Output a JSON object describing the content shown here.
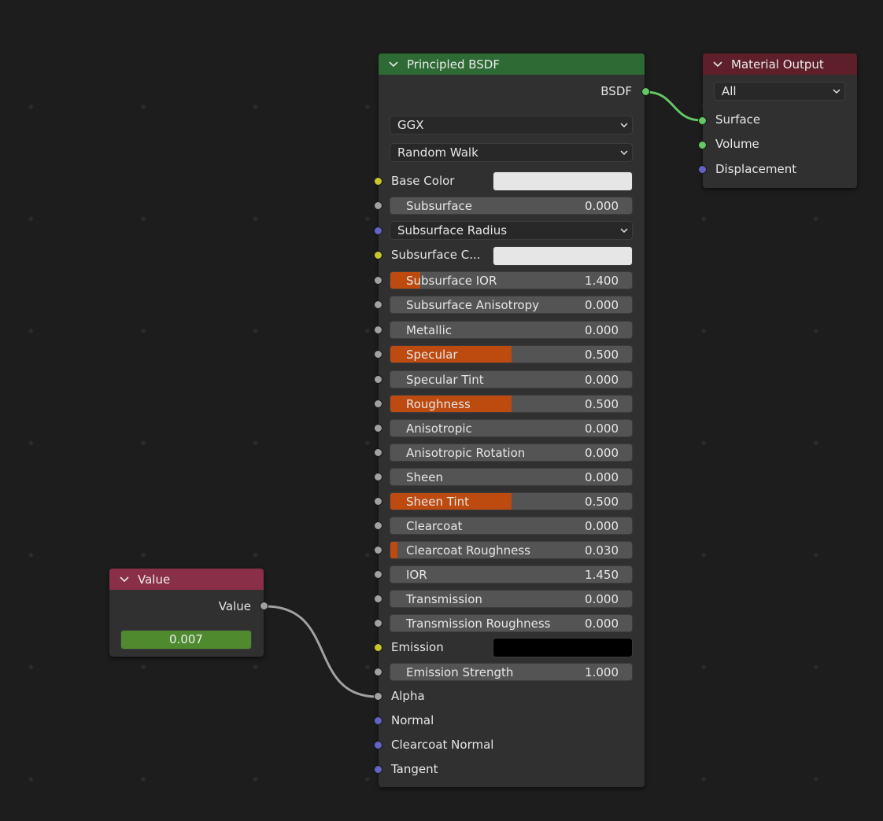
{
  "links_color_note": "",
  "value_node": {
    "title": "Value",
    "output_label": "Value",
    "value": "0.007",
    "header_color": "#8a2f48"
  },
  "bsdf_node": {
    "title": "Principled BSDF",
    "output_label": "BSDF",
    "header_color": "#2d6a34",
    "distribution": "GGX",
    "subsurface_method": "Random Walk",
    "base_color_label": "Base Color",
    "base_color": "#e6e6e6",
    "subsurface_radius_label": "Subsurface Radius",
    "subsurface_color_label": "Subsurface C...",
    "subsurface_color": "#e6e6e6",
    "emission_label": "Emission",
    "emission_color": "#000000",
    "sliders": [
      {
        "label": "Subsurface",
        "value": "0.000",
        "fill": 0.0
      },
      {
        "label": "Subsurface IOR",
        "value": "1.400",
        "fill": 0.125
      },
      {
        "label": "Subsurface Anisotropy",
        "value": "0.000",
        "fill": 0.0
      },
      {
        "label": "Metallic",
        "value": "0.000",
        "fill": 0.0
      },
      {
        "label": "Specular",
        "value": "0.500",
        "fill": 0.5
      },
      {
        "label": "Specular Tint",
        "value": "0.000",
        "fill": 0.0
      },
      {
        "label": "Roughness",
        "value": "0.500",
        "fill": 0.5
      },
      {
        "label": "Anisotropic",
        "value": "0.000",
        "fill": 0.0
      },
      {
        "label": "Anisotropic Rotation",
        "value": "0.000",
        "fill": 0.0
      },
      {
        "label": "Sheen",
        "value": "0.000",
        "fill": 0.0
      },
      {
        "label": "Sheen Tint",
        "value": "0.500",
        "fill": 0.5
      },
      {
        "label": "Clearcoat",
        "value": "0.000",
        "fill": 0.0
      },
      {
        "label": "Clearcoat Roughness",
        "value": "0.030",
        "fill": 0.03
      },
      {
        "label": "IOR",
        "value": "1.450",
        "fill": 0.0
      },
      {
        "label": "Transmission",
        "value": "0.000",
        "fill": 0.0
      },
      {
        "label": "Transmission Roughness",
        "value": "0.000",
        "fill": 0.0
      }
    ],
    "emission_strength": {
      "label": "Emission Strength",
      "value": "1.000",
      "fill": 0.0
    },
    "inputs_tail": [
      "Alpha",
      "Normal",
      "Clearcoat Normal",
      "Tangent"
    ]
  },
  "output_node": {
    "title": "Material Output",
    "header_color": "#5e1f2b",
    "target": "All",
    "inputs": [
      "Surface",
      "Volume",
      "Displacement"
    ]
  }
}
